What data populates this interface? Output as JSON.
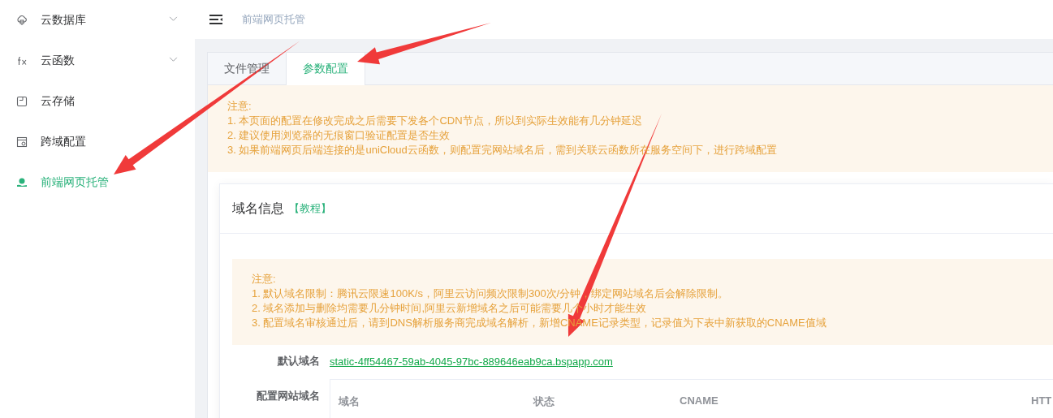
{
  "sidebar": {
    "items": [
      {
        "label": "云数据库",
        "expandable": true,
        "selected": false
      },
      {
        "label": "云函数",
        "expandable": true,
        "selected": false
      },
      {
        "label": "云存储",
        "expandable": false,
        "selected": false
      },
      {
        "label": "跨域配置",
        "expandable": false,
        "selected": false
      },
      {
        "label": "前端网页托管",
        "expandable": false,
        "selected": true
      }
    ]
  },
  "header": {
    "breadcrumb": "前端网页托管"
  },
  "tabs": [
    {
      "label": "文件管理",
      "selected": false
    },
    {
      "label": "参数配置",
      "selected": true
    }
  ],
  "notice": {
    "title": "注意:",
    "lines": [
      "1. 本页面的配置在修改完成之后需要下发各个CDN节点，所以到实际生效能有几分钟延迟",
      "2. 建议使用浏览器的无痕窗口验证配置是否生效",
      "3. 如果前端网页后端连接的是uniCloud云函数，则配置完网站域名后，需到关联云函数所在服务空间下，进行跨域配置"
    ]
  },
  "domain_card": {
    "title": "域名信息",
    "tutorial_link": "【教程】",
    "notice": {
      "title": "注意:",
      "lines": [
        "1. 默认域名限制：腾讯云限速100K/s，阿里云访问频次限制300次/分钟，绑定网站域名后会解除限制。",
        "2. 域名添加与删除均需要几分钟时间,阿里云新增域名之后可能需要几个小时才能生效",
        "3. 配置域名审核通过后，请到DNS解析服务商完成域名解析，新增CNAME记录类型，记录值为下表中新获取的CNAME值域"
      ]
    },
    "default_domain": {
      "label": "默认域名",
      "value": "static-4ff54467-59ab-4045-97bc-889646eab9ca.bspapp.com"
    },
    "site_domain": {
      "label": "配置网站域名",
      "table": {
        "columns": [
          "域名",
          "状态",
          "CNAME",
          "HTT"
        ]
      }
    }
  },
  "annotations": [
    {
      "kind": "arrow"
    },
    {
      "kind": "arrow"
    },
    {
      "kind": "arrow"
    }
  ]
}
